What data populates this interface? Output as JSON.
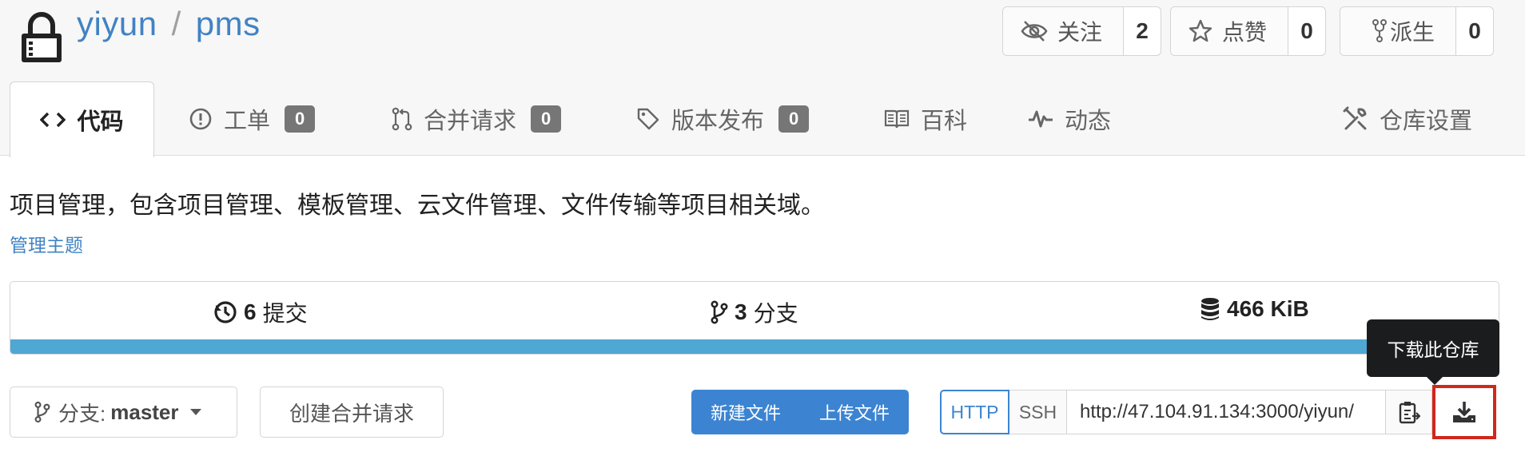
{
  "repo": {
    "owner": "yiyun",
    "separator": "/",
    "name": "pms",
    "description": "项目管理，包含项目管理、模板管理、云文件管理、文件传输等项目相关域。",
    "manage_topics": "管理主题"
  },
  "actions": {
    "watch": {
      "label": "关注",
      "count": "2",
      "icon": "eye-slash-icon"
    },
    "star": {
      "label": "点赞",
      "count": "0",
      "icon": "star-icon"
    },
    "fork": {
      "label": "派生",
      "count": "0",
      "icon": "fork-icon"
    }
  },
  "tabs": [
    {
      "label": "代码",
      "icon": "code-icon",
      "active": true
    },
    {
      "label": "工单",
      "badge": "0",
      "icon": "issue-icon"
    },
    {
      "label": "合并请求",
      "badge": "0",
      "icon": "pull-request-icon"
    },
    {
      "label": "版本发布",
      "badge": "0",
      "icon": "tag-icon"
    },
    {
      "label": "百科",
      "icon": "book-icon"
    },
    {
      "label": "动态",
      "icon": "pulse-icon"
    },
    {
      "label": "仓库设置",
      "icon": "tools-icon"
    }
  ],
  "stats": {
    "commits_count": "6",
    "commits_label": "提交",
    "branches_count": "3",
    "branches_label": "分支",
    "size": "466 KiB"
  },
  "toolbar": {
    "branch_prefix": "分支:",
    "branch_name": "master",
    "new_pr": "创建合并请求",
    "new_file": "新建文件",
    "upload_file": "上传文件",
    "proto_http": "HTTP",
    "proto_ssh": "SSH",
    "clone_url": "http://47.104.91.134:3000/yiyun/",
    "download_tooltip": "下载此仓库"
  },
  "colors": {
    "link": "#4183c4",
    "primary": "#3c84d2",
    "language_bar": "#4fa7d4",
    "highlight": "#d0281b"
  }
}
